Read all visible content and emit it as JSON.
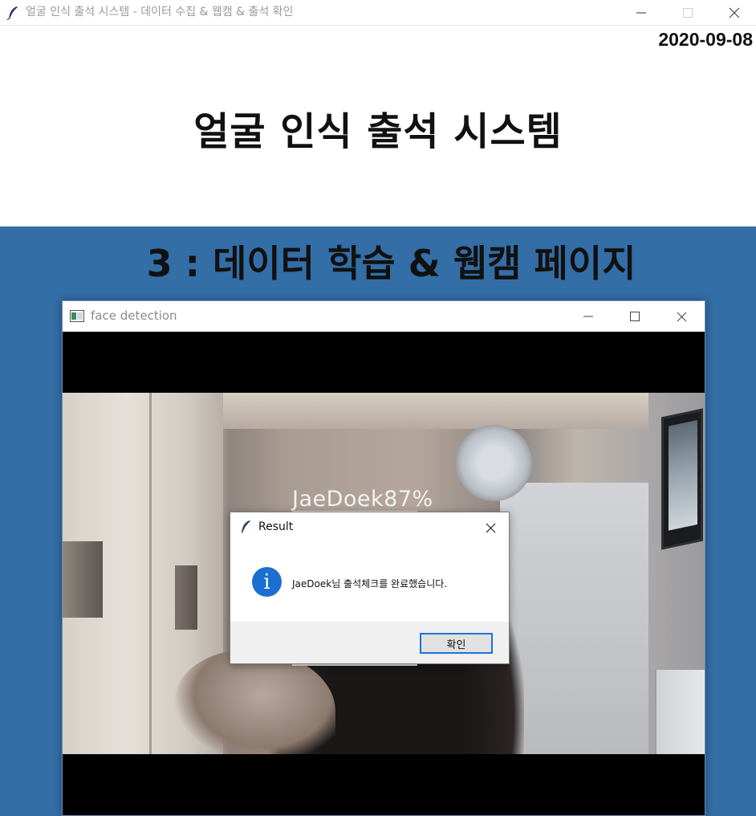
{
  "window": {
    "title": "얼굴 인식 출석 시스템 - 데이터 수집 & 웹캠 & 출석 확인",
    "icon": "feather-icon"
  },
  "header": {
    "date": "2020-09-08",
    "main_title": "얼굴 인식 출석 시스템"
  },
  "page": {
    "section_title": "3 : 데이터 학습 & 웹캠 페이지",
    "panel_color": "#336ea6"
  },
  "face_window": {
    "title": "face detection",
    "detection_label": "JaeDoek87%"
  },
  "dialog": {
    "title": "Result",
    "icon": "info-icon",
    "message": "JaeDoek님 출석체크를 완료했습니다.",
    "ok_label": "확인",
    "accent_color": "#1a74d6"
  }
}
